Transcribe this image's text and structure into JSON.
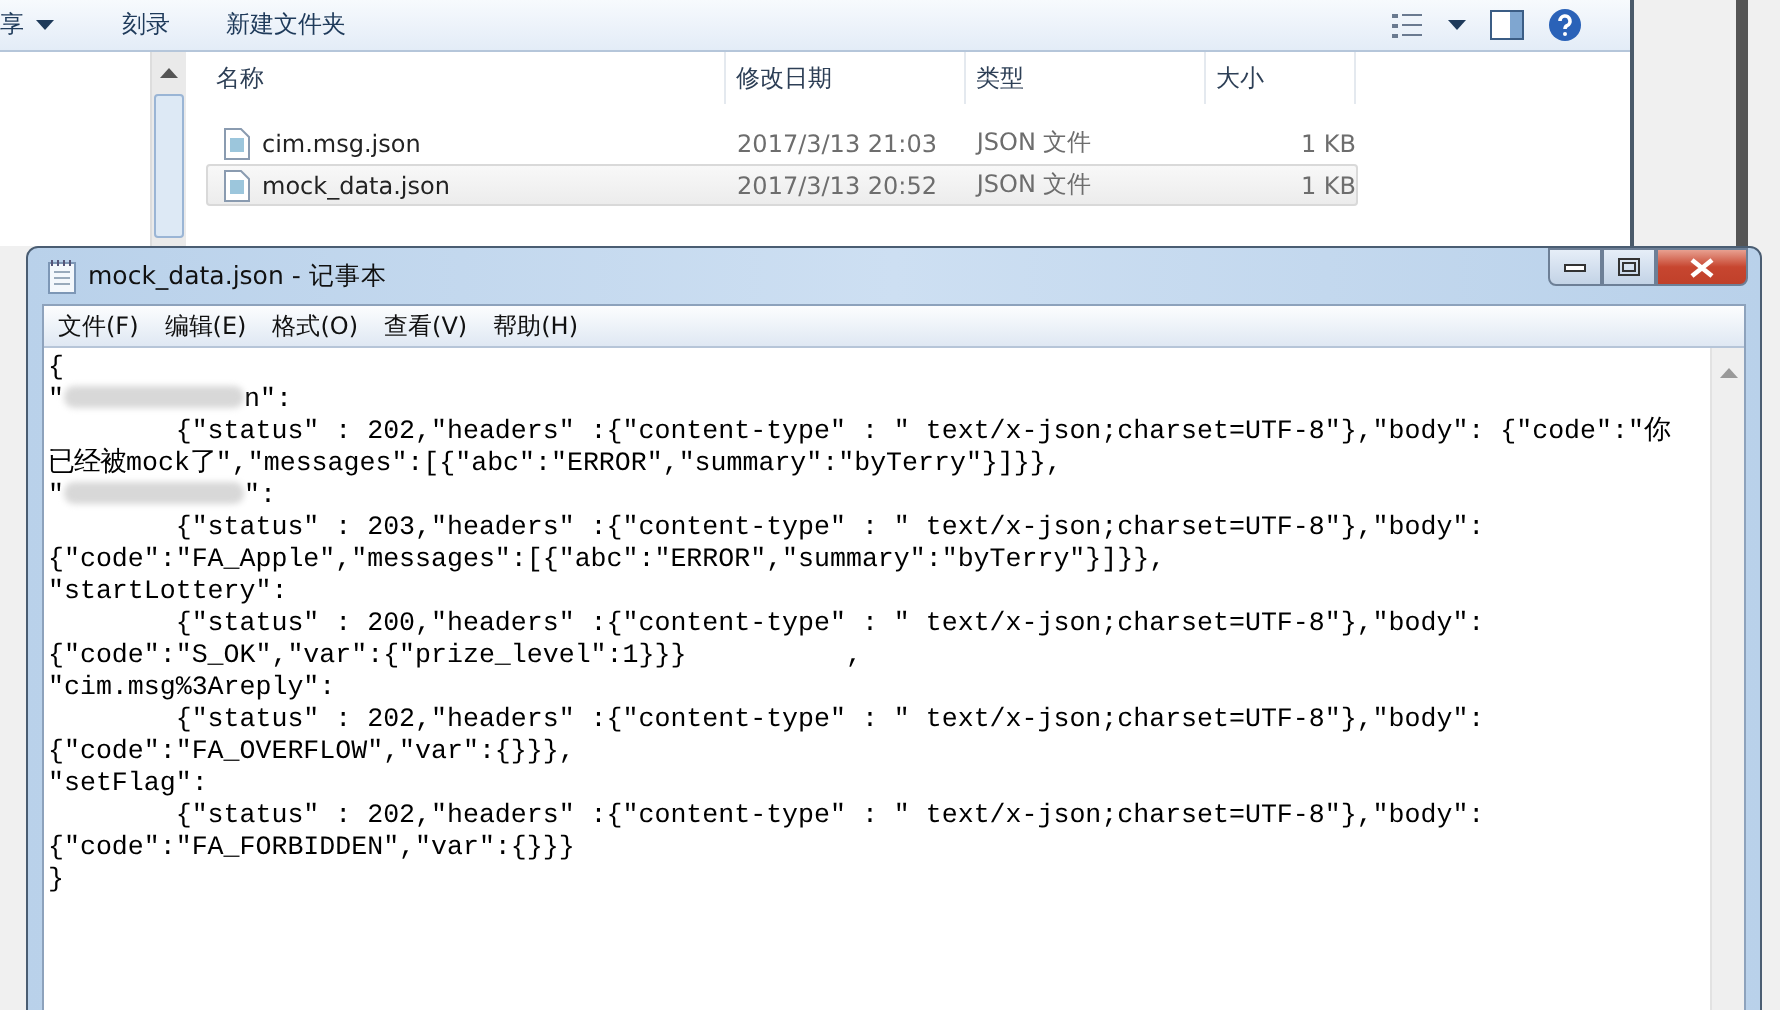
{
  "explorer": {
    "toolbar": [
      {
        "label": "享",
        "caret": true
      },
      {
        "label": "刻录",
        "caret": false
      },
      {
        "label": "新建文件夹",
        "caret": false
      }
    ],
    "columns": [
      "名称",
      "修改日期",
      "类型",
      "大小"
    ],
    "files": [
      {
        "name": "cim.msg.json",
        "modified": "2017/3/13 21:03",
        "type": "JSON 文件",
        "size": "1 KB",
        "selected": false
      },
      {
        "name": "mock_data.json",
        "modified": "2017/3/13 20:52",
        "type": "JSON 文件",
        "size": "1 KB",
        "selected": true
      }
    ]
  },
  "notepad": {
    "title": "mock_data.json - 记事本",
    "menu": [
      "文件(F)",
      "编辑(E)",
      "格式(O)",
      "查看(V)",
      "帮助(H)"
    ],
    "lines": [
      [
        {
          "kind": "text",
          "text": "{"
        }
      ],
      [
        {
          "kind": "text",
          "text": "\""
        },
        {
          "kind": "blur"
        },
        {
          "kind": "text",
          "text": "n\":"
        }
      ],
      [
        {
          "kind": "text",
          "text": "\t{\"status\" : 202,\"headers\" :{\"content-type\" : \" text/x-json;charset=UTF-8\"},\"body\": {\"code\":\"你"
        }
      ],
      [
        {
          "kind": "text",
          "text": "已经被mock了\",\"messages\":[{\"abc\":\"ERROR\",\"summary\":\"byTerry\"}]}},"
        }
      ],
      [
        {
          "kind": "text",
          "text": "\""
        },
        {
          "kind": "blur"
        },
        {
          "kind": "text",
          "text": "\":"
        }
      ],
      [
        {
          "kind": "text",
          "text": "\t{\"status\" : 203,\"headers\" :{\"content-type\" : \" text/x-json;charset=UTF-8\"},\"body\":"
        }
      ],
      [
        {
          "kind": "text",
          "text": "{\"code\":\"FA_Apple\",\"messages\":[{\"abc\":\"ERROR\",\"summary\":\"byTerry\"}]}},"
        }
      ],
      [
        {
          "kind": "text",
          "text": "\"startLottery\":"
        }
      ],
      [
        {
          "kind": "text",
          "text": "\t{\"status\" : 200,\"headers\" :{\"content-type\" : \" text/x-json;charset=UTF-8\"},\"body\":"
        }
      ],
      [
        {
          "kind": "text",
          "text": "{\"code\":\"S_OK\",\"var\":{\"prize_level\":1}}}          ,"
        }
      ],
      [
        {
          "kind": "text",
          "text": "\"cim.msg%3Areply\":"
        }
      ],
      [
        {
          "kind": "text",
          "text": "\t{\"status\" : 202,\"headers\" :{\"content-type\" : \" text/x-json;charset=UTF-8\"},\"body\":"
        }
      ],
      [
        {
          "kind": "text",
          "text": "{\"code\":\"FA_OVERFLOW\",\"var\":{}}},"
        }
      ],
      [
        {
          "kind": "text",
          "text": "\"setFlag\":"
        }
      ],
      [
        {
          "kind": "text",
          "text": "\t{\"status\" : 202,\"headers\" :{\"content-type\" : \" text/x-json;charset=UTF-8\"},\"body\":"
        }
      ],
      [
        {
          "kind": "text",
          "text": "{\"code\":\"FA_FORBIDDEN\",\"var\":{}}}"
        }
      ],
      [
        {
          "kind": "text",
          "text": "}"
        }
      ]
    ]
  }
}
